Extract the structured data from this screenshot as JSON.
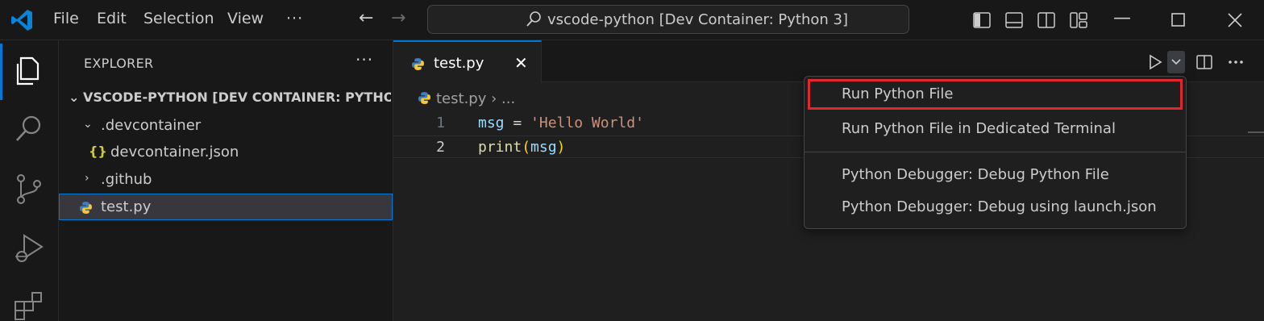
{
  "titlebar": {
    "logo_icon": "vscode-logo-icon",
    "menu": [
      "File",
      "Edit",
      "Selection",
      "View",
      "···"
    ],
    "back_icon": "arrow-left-icon",
    "forward_icon": "arrow-right-icon",
    "command_center_text": "vscode-python [Dev Container: Python 3]",
    "layout_icons": [
      "toggle-primary-sidebar-icon",
      "toggle-panel-icon",
      "toggle-secondary-sidebar-icon",
      "customize-layout-icon"
    ],
    "window_controls": [
      "minimize-icon",
      "maximize-icon",
      "close-icon"
    ]
  },
  "activitybar": {
    "items": [
      "explorer-icon",
      "search-icon",
      "source-control-icon",
      "run-debug-icon",
      "extensions-icon"
    ]
  },
  "sidebar": {
    "title": "EXPLORER",
    "more": "···",
    "section_title": "VSCODE-PYTHON [DEV CONTAINER: PYTHON...",
    "tree": [
      {
        "label": ".devcontainer",
        "type": "folder-open"
      },
      {
        "label": "devcontainer.json",
        "type": "json",
        "icon_text": "{}"
      },
      {
        "label": ".github",
        "type": "folder-closed"
      },
      {
        "label": "test.py",
        "type": "python",
        "selected": true
      }
    ]
  },
  "editor": {
    "tab": {
      "label": "test.py",
      "close": "✕"
    },
    "breadcrumb": {
      "file": "test.py",
      "sep": "›",
      "rest": "..."
    },
    "lines": [
      {
        "num": "1",
        "tokens": {
          "a": "msg",
          "b": " = ",
          "c": "'Hello World'"
        }
      },
      {
        "num": "2",
        "tokens": {
          "a": "print",
          "b": "(",
          "c": "msg",
          "d": ")"
        }
      }
    ],
    "actions": [
      "run-icon",
      "chevron-down-icon",
      "split-editor-icon",
      "more-actions-icon"
    ]
  },
  "run_menu": {
    "items": [
      "Run Python File",
      "Run Python File in Dedicated Terminal",
      "Python Debugger: Debug Python File",
      "Python Debugger: Debug using launch.json"
    ],
    "highlighted_index": 0,
    "highlight_color": "#e0262f"
  },
  "colors": {
    "accent": "#0078d4",
    "string": "#ce9178",
    "variable": "#9cdcfe",
    "function": "#dcdcaa"
  }
}
